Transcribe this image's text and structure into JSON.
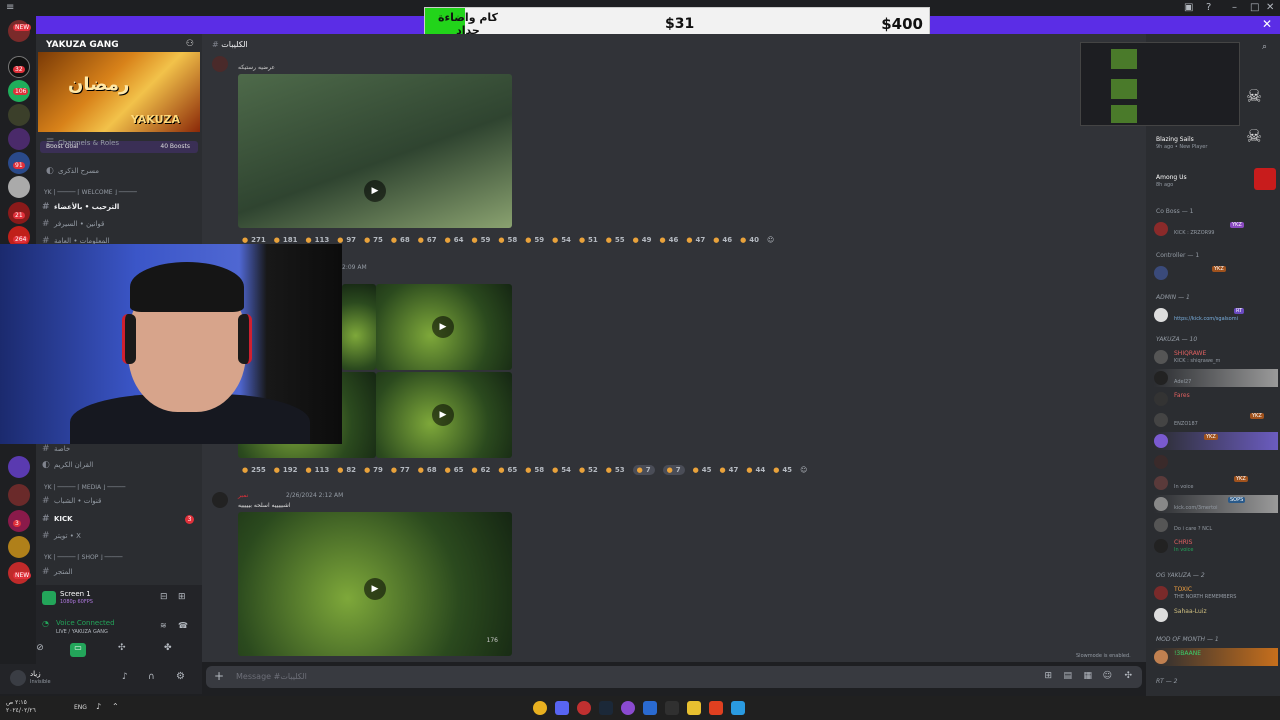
{
  "banner": {
    "left_text": "كام واضاءة جداد",
    "current": "$31",
    "goal": "$400"
  },
  "rail": {
    "badges": [
      "NEW",
      "32",
      "NEW",
      "106",
      "1",
      "91",
      "21",
      "264",
      "3",
      "NEW"
    ]
  },
  "server": {
    "name": "YAKUZA GANG",
    "banner_text_ar": "رمضان",
    "banner_text_en": "YAKUZA",
    "boost_goal": "Boost Goal",
    "boost_count": "40 Boosts",
    "channels_roles": "Channels & Roles"
  },
  "channels": [
    {
      "label": "مسرح الذكرى",
      "type": "voice",
      "bright": false
    },
    {
      "label": "WELCOME",
      "type": "category"
    },
    {
      "label": "الترحيب • بالأعضاء",
      "type": "text",
      "bright": true
    },
    {
      "label": "قوانين • السيرفر",
      "type": "text",
      "bright": false
    },
    {
      "label": "المعلومات • العامة",
      "type": "text",
      "bright": false
    },
    {
      "label": "خاصة",
      "type": "text",
      "bright": false
    },
    {
      "label": "القران الكريم",
      "type": "voice",
      "bright": false
    },
    {
      "label": "MEDIA",
      "type": "category"
    },
    {
      "label": "قنوات • الشباب",
      "type": "text",
      "bright": false
    },
    {
      "label": "KICK",
      "type": "text",
      "bright": true
    },
    {
      "label": "تويتر • X",
      "type": "text",
      "bright": false
    },
    {
      "label": "SHOP",
      "type": "category"
    },
    {
      "label": "المتجر",
      "type": "text",
      "bright": false
    }
  ],
  "screen_share": {
    "title": "Screen 1",
    "subtitle": "1080p 60FPS",
    "voice_status": "Voice Connected",
    "voice_channel": "LIVE / YAKUZA GANG"
  },
  "user": {
    "name": "زياد",
    "status": "Invisible"
  },
  "chat": {
    "channel_name": "الكليبات",
    "composer_placeholder": "Message #الكليبات",
    "slowmode": "Slowmode is enabled.",
    "messages": [
      {
        "text": "عرضيه رستيكه",
        "reactions": [
          "271",
          "181",
          "113",
          "97",
          "75",
          "68",
          "67",
          "64",
          "59",
          "58",
          "59",
          "54",
          "51",
          "55",
          "49",
          "46",
          "47",
          "46",
          "40"
        ]
      },
      {
        "time": "2:09 AM",
        "reactions": [
          "255",
          "192",
          "113",
          "82",
          "79",
          "77",
          "68",
          "65",
          "62",
          "65",
          "58",
          "54",
          "52",
          "53",
          "7",
          "7",
          "45",
          "47",
          "44",
          "45"
        ]
      },
      {
        "author": "نمبر",
        "time": "2/26/2024 2:12 AM",
        "text": "اشبييييه اسلحه بيييييه",
        "video_counter": "176"
      }
    ]
  },
  "members": {
    "activity": [
      {
        "name": "Blazing Sails",
        "status": "9h ago • New Player"
      },
      {
        "name": "Among Us",
        "status": "8h ago"
      }
    ],
    "sections": [
      {
        "title": "Co Boss — 1",
        "list": [
          {
            "name": "YKZ",
            "status": "KICK : ZRZOR99"
          }
        ]
      },
      {
        "title": "Controller — 1",
        "list": [
          {
            "name": "YKZ",
            "status": ""
          }
        ]
      },
      {
        "title": "ADMIN — 1",
        "list": [
          {
            "name": "RT",
            "status": "https://kick.com/sgalsomi"
          }
        ]
      },
      {
        "title": "YAKUZA — 10",
        "list": [
          {
            "name": "SHIQRAWE",
            "status": "KICK : shiqrawe_m"
          },
          {
            "name": "",
            "status": "Adel27"
          },
          {
            "name": "Fares",
            "status": ""
          },
          {
            "name": "YKZ",
            "status": "ENZO187"
          },
          {
            "name": "YKZ",
            "status": ""
          },
          {
            "name": "",
            "status": ""
          },
          {
            "name": "YKZ",
            "status": "In voice"
          },
          {
            "name": "SOPS",
            "status": "kick.com/3mertoi"
          },
          {
            "name": "",
            "status": "Do i care ? NCL"
          },
          {
            "name": "CHRIS",
            "status": "In voice"
          }
        ]
      },
      {
        "title": "OG YAKUZA — 2",
        "list": [
          {
            "name": "TOXIC",
            "status": "THE NORTH REMEMBERS"
          },
          {
            "name": "Sahaa-Luiz",
            "status": ""
          }
        ]
      },
      {
        "title": "MOD OF MONTH — 1",
        "list": [
          {
            "name": "!3BAANE",
            "status": ""
          }
        ]
      },
      {
        "title": "RT — 2",
        "list": []
      }
    ]
  },
  "taskbar": {
    "time": "٢:١٥ ص",
    "date": "٢٠٢٤/٠٢/٢٦",
    "lang": "ENG"
  }
}
